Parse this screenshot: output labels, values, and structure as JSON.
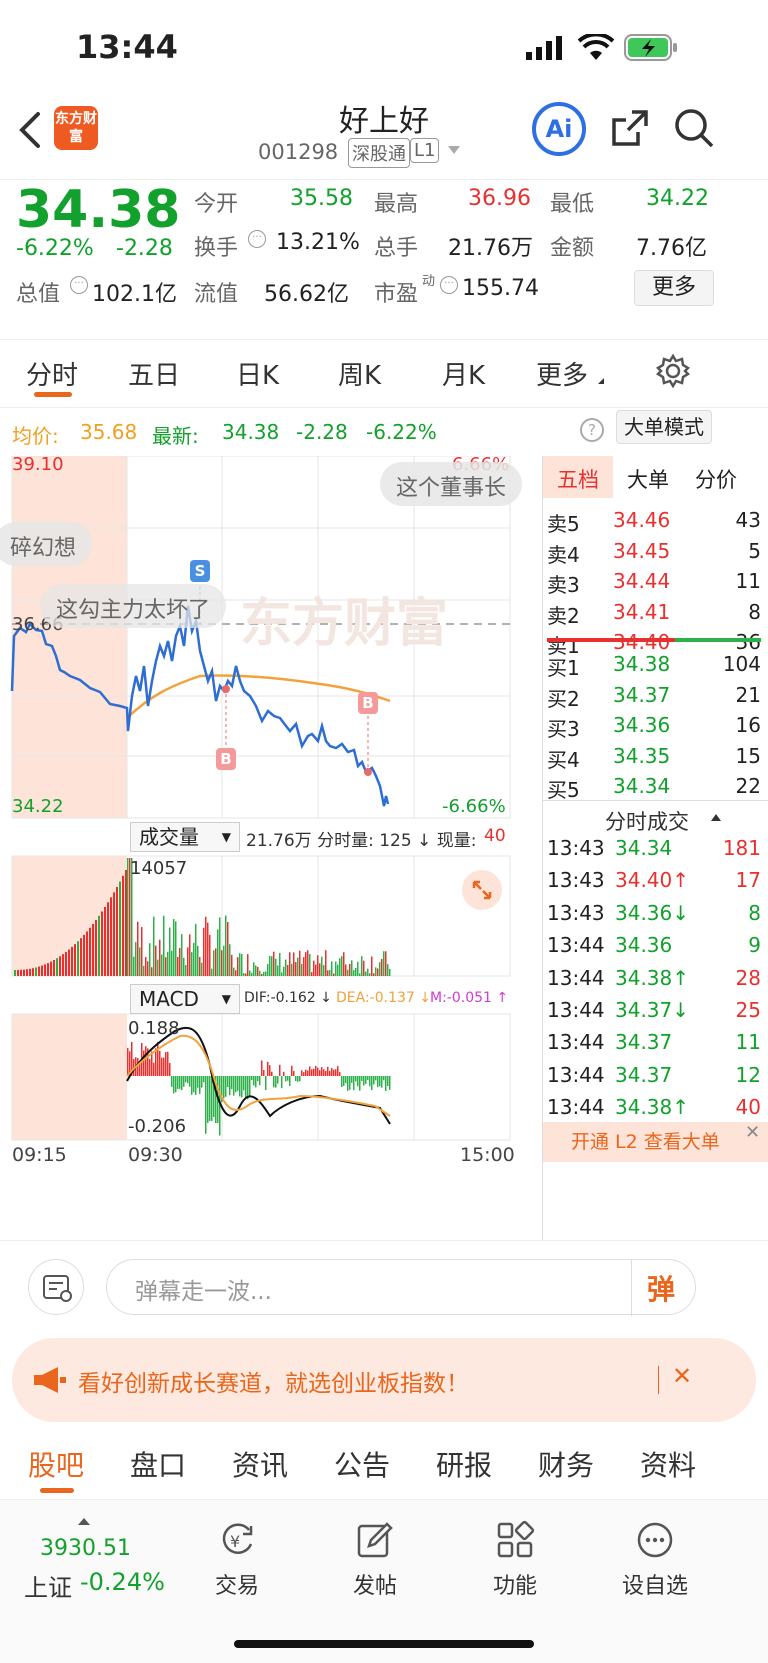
{
  "status": {
    "time": "13:44"
  },
  "header": {
    "title": "好上好",
    "code": "001298",
    "tag1": "深股通",
    "tag2": "L1",
    "logo_text": "东方财富",
    "ai_label": "Ai"
  },
  "quote": {
    "price": "34.38",
    "pct": "-6.22%",
    "change": "-2.28",
    "open_label": "今开",
    "open": "35.58",
    "high_label": "最高",
    "high": "36.96",
    "low_label": "最低",
    "low": "34.22",
    "turnover_label": "换手",
    "turnover": "13.21%",
    "vol_label": "总手",
    "vol": "21.76万",
    "amount_label": "金额",
    "amount": "7.76亿",
    "mktcap_label": "总值",
    "mktcap": "102.1亿",
    "float_label": "流值",
    "float": "56.62亿",
    "pe_label": "市盈",
    "pe_sup": "动",
    "pe": "155.74",
    "more_btn": "更多"
  },
  "tabs": [
    "分时",
    "五日",
    "日K",
    "周K",
    "月K",
    "更多"
  ],
  "avgline": {
    "avg_label": "均价:",
    "avg": "35.68",
    "latest_label": "最新:",
    "latest": "34.38",
    "chg": "-2.28",
    "pct": "-6.22%",
    "bigorder_btn": "大单模式"
  },
  "chart": {
    "top_left": "39.10",
    "top_right": "6.66%",
    "mid_left": "36.66",
    "bot_left": "34.22",
    "bot_right": "-6.66%",
    "bubbles": [
      "这个董事长",
      "碎幻想",
      "这勾主力太坏了"
    ],
    "marker_s": "S",
    "marker_b": "B",
    "watermark": "东方财富",
    "vol_btn": "成交量",
    "vol_info": "21.76万 分时量: 125 ↓ 现量:",
    "vol_now": "40",
    "vol_max": "14057",
    "macd_btn": "MACD",
    "dif": "DIF:-0.162 ↓",
    "dea": "DEA:-0.137 ↓",
    "m": "M:-0.051 ↑",
    "macd_top": "0.188",
    "macd_bot": "-0.206",
    "t_start": "09:15",
    "t_open": "09:30",
    "t_end": "15:00"
  },
  "order_book": {
    "tabs": [
      "五档",
      "大单",
      "分价"
    ],
    "sells": [
      {
        "label": "卖5",
        "price": "34.46",
        "vol": "43"
      },
      {
        "label": "卖4",
        "price": "34.45",
        "vol": "5"
      },
      {
        "label": "卖3",
        "price": "34.44",
        "vol": "11"
      },
      {
        "label": "卖2",
        "price": "34.41",
        "vol": "8"
      },
      {
        "label": "卖1",
        "price": "34.40",
        "vol": "36"
      }
    ],
    "buys": [
      {
        "label": "买1",
        "price": "34.38",
        "vol": "104"
      },
      {
        "label": "买2",
        "price": "34.37",
        "vol": "21"
      },
      {
        "label": "买3",
        "price": "34.36",
        "vol": "16"
      },
      {
        "label": "买4",
        "price": "34.35",
        "vol": "15"
      },
      {
        "label": "买5",
        "price": "34.34",
        "vol": "22"
      }
    ],
    "trades_title": "分时成交",
    "trades": [
      {
        "t": "13:43",
        "p": "34.34",
        "v": "181",
        "dir": "",
        "pc": "green",
        "vc": "red"
      },
      {
        "t": "13:43",
        "p": "34.40↑",
        "v": "17",
        "dir": "",
        "pc": "red",
        "vc": "red"
      },
      {
        "t": "13:43",
        "p": "34.36↓",
        "v": "8",
        "dir": "",
        "pc": "green",
        "vc": "green"
      },
      {
        "t": "13:44",
        "p": "34.36",
        "v": "9",
        "dir": "",
        "pc": "green",
        "vc": "green"
      },
      {
        "t": "13:44",
        "p": "34.38↑",
        "v": "28",
        "dir": "",
        "pc": "green",
        "vc": "red"
      },
      {
        "t": "13:44",
        "p": "34.37↓",
        "v": "25",
        "dir": "",
        "pc": "green",
        "vc": "red"
      },
      {
        "t": "13:44",
        "p": "34.37",
        "v": "11",
        "dir": "",
        "pc": "green",
        "vc": "green"
      },
      {
        "t": "13:44",
        "p": "34.37",
        "v": "12",
        "dir": "",
        "pc": "green",
        "vc": "green"
      },
      {
        "t": "13:44",
        "p": "34.38↑",
        "v": "40",
        "dir": "",
        "pc": "green",
        "vc": "red"
      }
    ],
    "l2_banner": "开通 L2 查看大单"
  },
  "danmu": {
    "placeholder": "弹幕走一波...",
    "btn": "弹"
  },
  "ad": {
    "text": "看好创新成长赛道，就选创业板指数！"
  },
  "bottom_tabs": [
    "股吧",
    "盘口",
    "资讯",
    "公告",
    "研报",
    "财务",
    "资料"
  ],
  "footer": {
    "index_value": "3930.51",
    "index_name": "上证",
    "index_pct": "-0.24%",
    "items": [
      "交易",
      "发帖",
      "功能",
      "设自选"
    ]
  }
}
